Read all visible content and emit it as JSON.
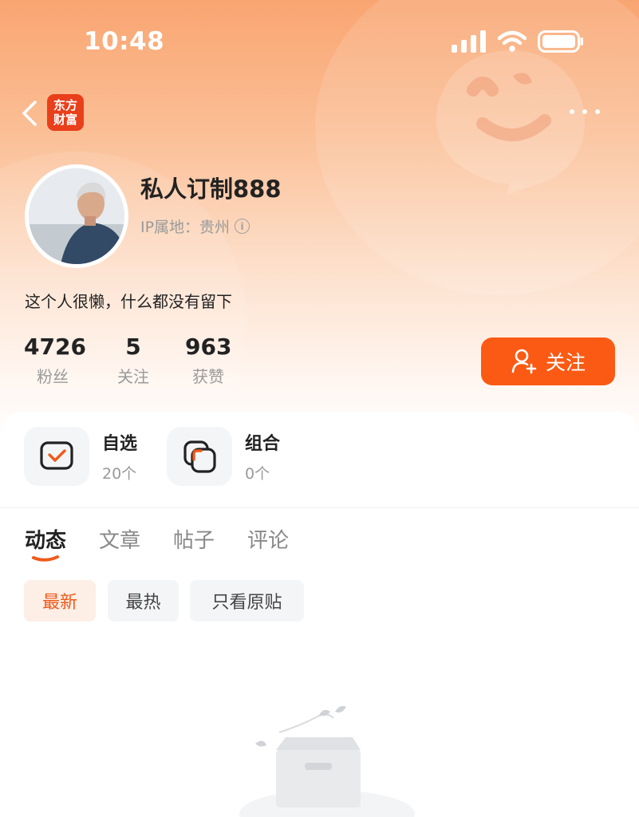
{
  "status_bar": {
    "time": "10:48"
  },
  "nav": {
    "logo_line1": "东方",
    "logo_line2": "财富"
  },
  "profile": {
    "username": "私人订制888",
    "ip_label": "IP属地：贵州",
    "bio": "这个人很懒，什么都没有留下"
  },
  "stats": [
    {
      "value": "4726",
      "label": "粉丝"
    },
    {
      "value": "5",
      "label": "关注"
    },
    {
      "value": "963",
      "label": "获赞"
    }
  ],
  "follow_button": {
    "label": "关注"
  },
  "shortcuts": [
    {
      "title": "自选",
      "count": "20个"
    },
    {
      "title": "组合",
      "count": "0个"
    }
  ],
  "tabs": [
    {
      "label": "动态",
      "active": true
    },
    {
      "label": "文章",
      "active": false
    },
    {
      "label": "帖子",
      "active": false
    },
    {
      "label": "评论",
      "active": false
    }
  ],
  "filters": [
    {
      "label": "最新",
      "active": true
    },
    {
      "label": "最热",
      "active": false
    },
    {
      "label": "只看原贴",
      "active": false
    }
  ],
  "colors": {
    "accent": "#fa5a14",
    "logo": "#e93f1b",
    "hero_top": "#f9a571"
  },
  "icons": {
    "back": "chevron-left-icon",
    "more": "more-dots-icon",
    "follow": "add-user-icon",
    "watchlist": "watchlist-check-icon",
    "portfolio": "portfolio-icon",
    "info": "info-icon"
  }
}
